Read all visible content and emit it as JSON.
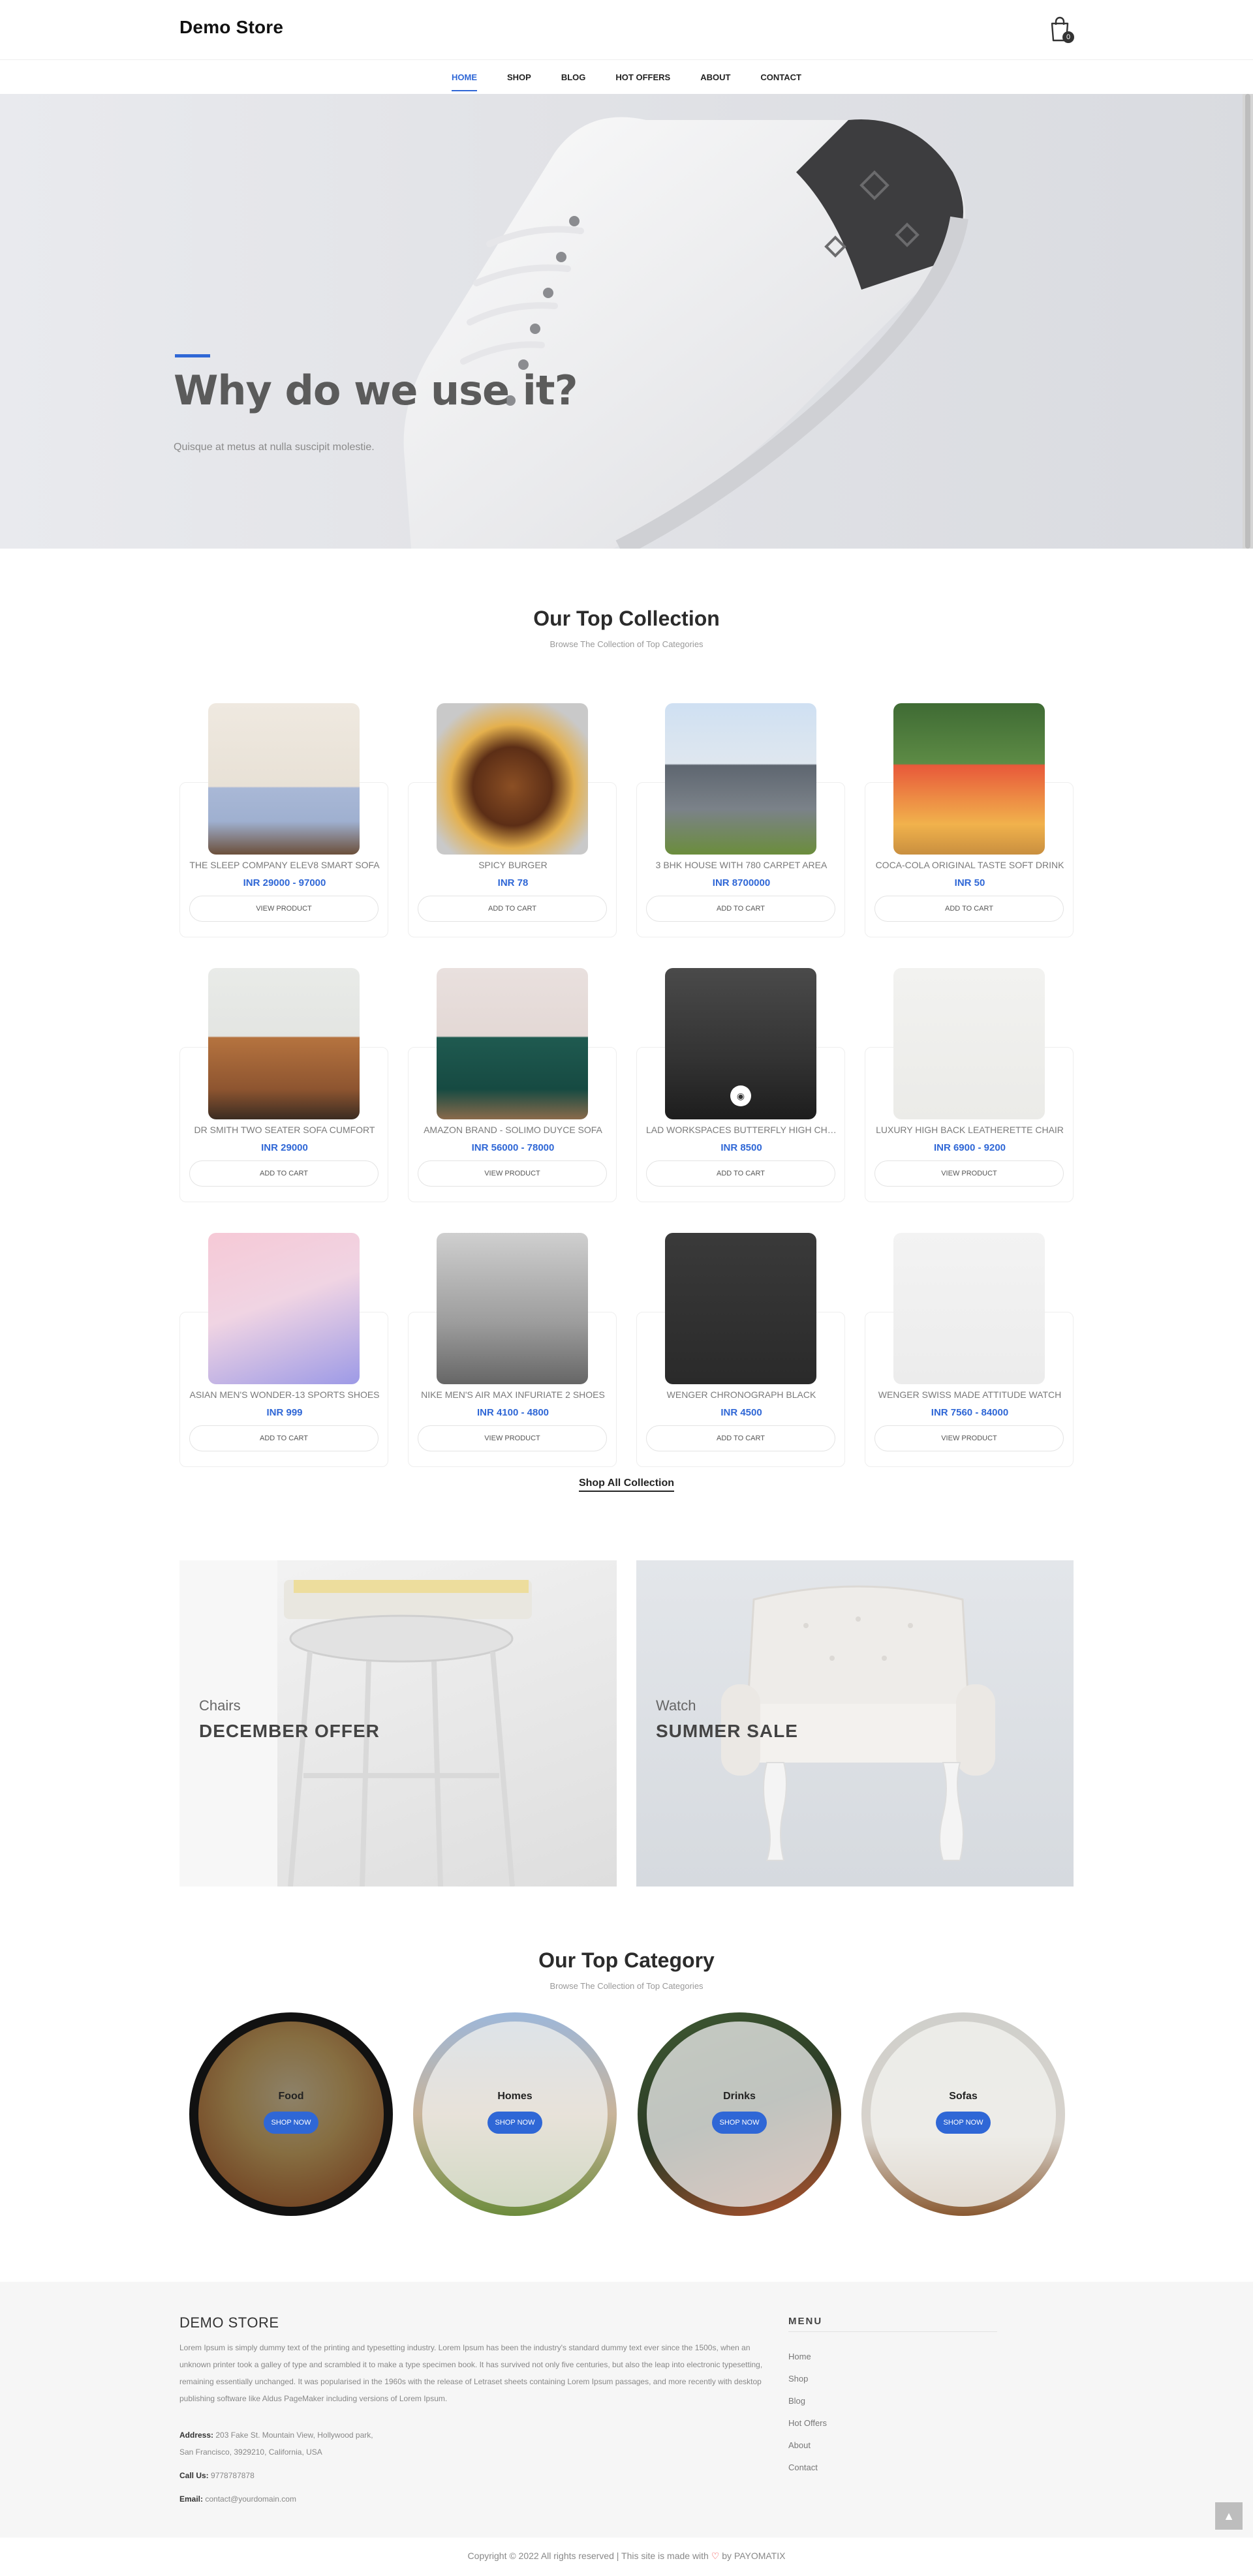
{
  "header": {
    "brand": "Demo Store",
    "cart_count": "0",
    "nav": [
      "HOME",
      "SHOP",
      "BLOG",
      "HOT OFFERS",
      "ABOUT",
      "CONTACT"
    ]
  },
  "hero": {
    "title": "Why do we use it?",
    "text": "Quisque at metus at nulla suscipit molestie."
  },
  "collection": {
    "title": "Our Top Collection",
    "subtitle": "Browse The Collection of Top Categories",
    "products": [
      {
        "name": "THE SLEEP COMPANY ELEV8 SMART SOFA",
        "price": "INR 29000 - 97000",
        "button": "VIEW PRODUCT"
      },
      {
        "name": "SPICY BURGER",
        "price": "INR 78",
        "button": "ADD TO CART"
      },
      {
        "name": "3 BHK HOUSE WITH 780 CARPET AREA",
        "price": "INR 8700000",
        "button": "ADD TO CART"
      },
      {
        "name": "COCA-COLA ORIGINAL TASTE SOFT DRINK",
        "price": "INR 50",
        "button": "ADD TO CART"
      },
      {
        "name": "DR SMITH TWO SEATER SOFA CUMFORT",
        "price": "INR 29000",
        "button": "ADD TO CART"
      },
      {
        "name": "AMAZON BRAND - SOLIMO DUYCE SOFA",
        "price": "INR 56000 - 78000",
        "button": "VIEW PRODUCT"
      },
      {
        "name": "LAD WORKSPACES BUTTERFLY HIGH CHAIR",
        "price": "INR 8500",
        "button": "ADD TO CART"
      },
      {
        "name": "LUXURY HIGH BACK LEATHERETTE CHAIR",
        "price": "INR 6900 - 9200",
        "button": "VIEW PRODUCT"
      },
      {
        "name": "ASIAN MEN'S WONDER-13 SPORTS SHOES",
        "price": "INR 999",
        "button": "ADD TO CART"
      },
      {
        "name": "NIKE MEN'S AIR MAX INFURIATE 2 SHOES",
        "price": "INR 4100 - 4800",
        "button": "VIEW PRODUCT"
      },
      {
        "name": "WENGER CHRONOGRAPH BLACK",
        "price": "INR 4500",
        "button": "ADD TO CART"
      },
      {
        "name": "WENGER SWISS MADE ATTITUDE WATCH",
        "price": "INR 7560 - 84000",
        "button": "VIEW PRODUCT"
      }
    ],
    "shop_all": "Shop All Collection"
  },
  "banners": [
    {
      "category": "Chairs",
      "title": "DECEMBER OFFER"
    },
    {
      "category": "Watch",
      "title": "SUMMER SALE"
    }
  ],
  "categories": {
    "title": "Our Top Category",
    "subtitle": "Browse The Collection of Top Categories",
    "items": [
      {
        "label": "Food",
        "button": "SHOP NOW"
      },
      {
        "label": "Homes",
        "button": "SHOP NOW"
      },
      {
        "label": "Drinks",
        "button": "SHOP NOW"
      },
      {
        "label": "Sofas",
        "button": "SHOP NOW"
      }
    ]
  },
  "footer": {
    "brand": "DEMO STORE",
    "text": "Lorem Ipsum is simply dummy text of the printing and typesetting industry. Lorem Ipsum has been the industry's standard dummy text ever since the 1500s, when an unknown printer took a galley of type and scrambled it to make a type specimen book. It has survived not only five centuries, but also the leap into electronic typesetting, remaining essentially unchanged. It was popularised in the 1960s with the release of Letraset sheets containing Lorem Ipsum passages, and more recently with desktop publishing software like Aldus PageMaker including versions of Lorem Ipsum.",
    "address_label": "Address:",
    "address_line1": "203 Fake St. Mountain View, Hollywood park,",
    "address_line2": "San Francisco, 3929210, California, USA",
    "call_label": "Call Us:",
    "call_value": "9778787878",
    "email_label": "Email:",
    "email_value": "contact@yourdomain.com",
    "menu_title": "MENU",
    "menu": [
      "Home",
      "Shop",
      "Blog",
      "Hot Offers",
      "About",
      "Contact"
    ],
    "copyright_pre": "Copyright © 2022 All rights reserved | This site is made with",
    "copyright_heart": "♡",
    "copyright_post": "by PAYOMATIX"
  },
  "colors": {
    "accent": "#2f67d6"
  }
}
